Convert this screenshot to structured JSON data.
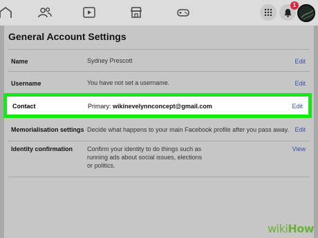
{
  "topbar": {
    "icons": [
      "friends-icon",
      "watch-icon",
      "marketplace-icon",
      "gaming-icon"
    ],
    "notification_badge": "1"
  },
  "panel": {
    "title": "General Account Settings",
    "rows": [
      {
        "label": "Name",
        "value": "Sydney Prescott",
        "action": "Edit"
      },
      {
        "label": "Username",
        "value": "You have not set a username.",
        "action": "Edit"
      },
      {
        "label": "Contact",
        "value_prefix": "Primary:",
        "value": "wikinevelynnconcept@gmail.com",
        "action": "Edit"
      },
      {
        "label": "Memorialisation settings",
        "value": "Decide what happens to your main Facebook profile after you pass away.",
        "action": "Edit"
      },
      {
        "label": "Identity confirmation",
        "value": "Confirm your identity to do things such as running ads about social issues, elections or politics.",
        "action": "View"
      }
    ]
  },
  "watermark": {
    "wiki": "wiki",
    "how": "How"
  },
  "colors": {
    "highlight": "#19e619",
    "link": "#3a4fa8",
    "badge": "#d7263d"
  }
}
